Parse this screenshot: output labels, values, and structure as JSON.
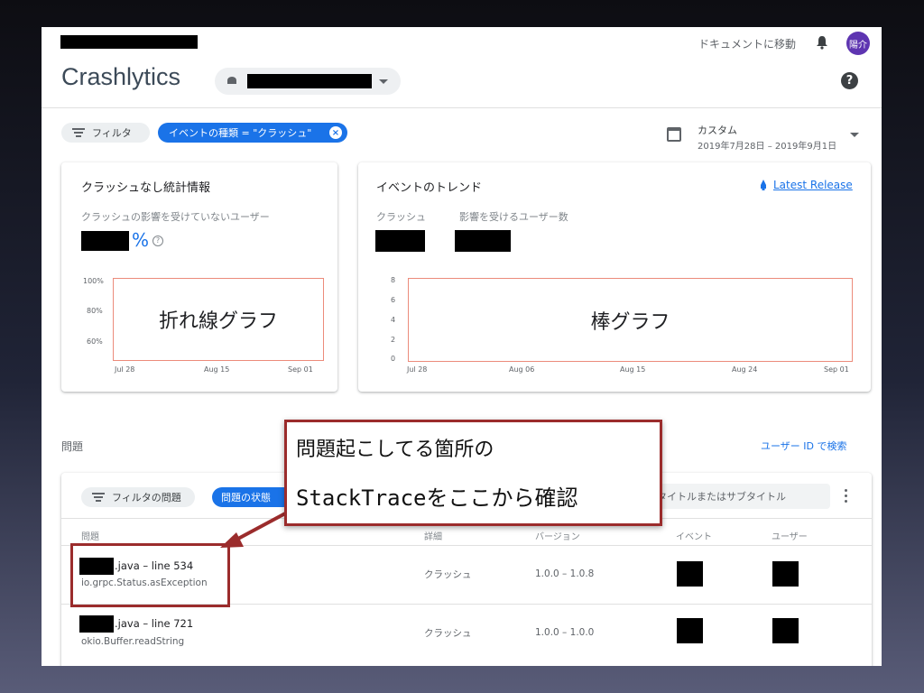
{
  "header": {
    "doc_link": "ドキュメントに移動",
    "avatar_text": "陽介",
    "app_title": "Crashlytics",
    "help_symbol": "?"
  },
  "filters": {
    "filter_label": "フィルタ",
    "event_chip": "イベントの種類 = \"クラッシュ\"",
    "range_label": "カスタム",
    "range_value": "2019年7月28日 – 2019年9月1日"
  },
  "crash_free_card": {
    "title": "クラッシュなし統計情報",
    "subtitle": "クラッシュの影響を受けていないユーザー",
    "percent_sign": "%",
    "y_ticks": [
      "100%",
      "80%",
      "60%"
    ],
    "x_ticks": [
      "Jul 28",
      "Aug 15",
      "Sep 01"
    ],
    "placeholder": "折れ線グラフ"
  },
  "trend_card": {
    "title": "イベントのトレンド",
    "latest_release": "Latest Release",
    "metric_crash": "クラッシュ",
    "metric_users": "影響を受けるユーザー数",
    "y_ticks": [
      "8",
      "6",
      "4",
      "2",
      "0"
    ],
    "x_ticks": [
      "Jul 28",
      "Aug 06",
      "Aug 15",
      "Aug 24",
      "Sep 01"
    ],
    "placeholder": "棒グラフ"
  },
  "issues": {
    "section_title": "問題",
    "user_search": "ユーザー ID で検索",
    "filter_label": "フィルタの問題",
    "state_chip": "問題の状態",
    "search_placeholder": "タイトルまたはサブタイトル",
    "columns": [
      "問題",
      "詳細",
      "バージョン",
      "イベント",
      "ユーザー"
    ],
    "rows": [
      {
        "file": ".java – line 534",
        "sub": "io.grpc.Status.asException",
        "detail": "クラッシュ",
        "version": "1.0.0 – 1.0.8"
      },
      {
        "file": ".java – line 721",
        "sub": "okio.Buffer.readString",
        "detail": "クラッシュ",
        "version": "1.0.0 – 1.0.0"
      }
    ]
  },
  "annotation": {
    "line1": "問題起こしてる箇所の",
    "line2": "StackTraceをここから確認"
  },
  "colors": {
    "accent": "#1a73e8",
    "annotation": "#9b2c2c",
    "chart_placeholder_border": "#ec8b7b"
  }
}
